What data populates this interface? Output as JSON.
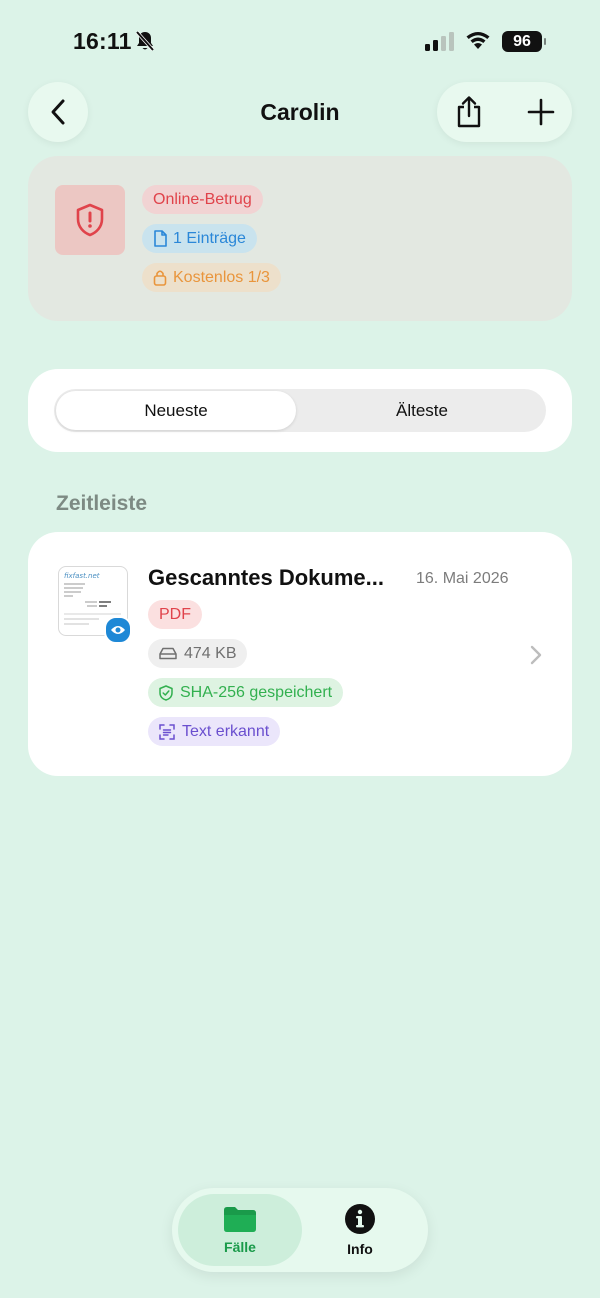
{
  "status_bar": {
    "time": "16:11",
    "battery": "96"
  },
  "nav": {
    "title": "Carolin"
  },
  "case": {
    "category": "Online-Betrug",
    "entries": "1 Einträge",
    "plan": "Kostenlos 1/3"
  },
  "sort": {
    "newest": "Neueste",
    "oldest": "Älteste",
    "selected": "Neueste"
  },
  "timeline": {
    "section_title": "Zeitleiste",
    "items": [
      {
        "title": "Gescanntes Dokume...",
        "date": "16. Mai 2026",
        "type": "PDF",
        "size": "474 KB",
        "hash": "SHA-256 gespeichert",
        "ocr": "Text erkannt"
      }
    ]
  },
  "tabbar": {
    "cases": "Fälle",
    "info": "Info",
    "selected": "Fälle"
  },
  "colors": {
    "background": "#dcf3e8",
    "accent_green": "#1a9a4a",
    "danger_red": "#e0434b",
    "info_blue": "#2a87d8",
    "warning_orange": "#e9953c",
    "ocr_purple": "#6a4fcf"
  }
}
